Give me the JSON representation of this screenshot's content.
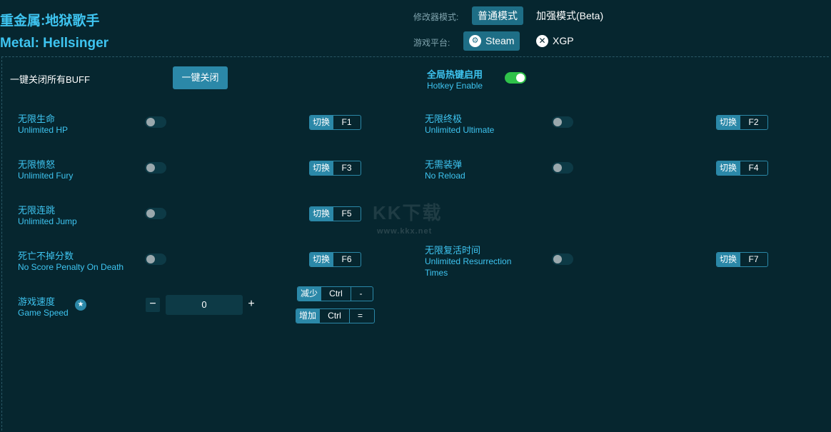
{
  "header": {
    "title_cn": "重金属:地狱歌手",
    "title_en": "Metal: Hellsinger",
    "mode_label": "修改器模式:",
    "mode_normal": "普通模式",
    "mode_enhanced": "加强模式(Beta)",
    "platform_label": "游戏平台:",
    "platform_steam": "Steam",
    "platform_xgp": "XGP",
    "steam_icon": "steam-icon",
    "xbox_icon": "xbox-icon"
  },
  "global": {
    "buff_label": "一键关闭所有BUFF",
    "close_all_button": "一键关闭",
    "hotkey_cn": "全局热键启用",
    "hotkey_en": "Hotkey Enable",
    "hotkey_enabled": true
  },
  "options": [
    {
      "cn": "无限生命",
      "en": "Unlimited HP",
      "action": "切换",
      "key": "F1"
    },
    {
      "cn": "无限终极",
      "en": "Unlimited Ultimate",
      "action": "切换",
      "key": "F2"
    },
    {
      "cn": "无限愤怒",
      "en": "Unlimited Fury",
      "action": "切换",
      "key": "F3"
    },
    {
      "cn": "无需装弹",
      "en": "No Reload",
      "action": "切换",
      "key": "F4"
    },
    {
      "cn": "无限连跳",
      "en": "Unlimited Jump",
      "action": "切换",
      "key": "F5"
    },
    {
      "cn": "死亡不掉分数",
      "en": "No Score Penalty On Death",
      "action": "切换",
      "key": "F6"
    },
    {
      "cn": "无限复活时间",
      "en": "Unlimited Resurrection Times",
      "action": "切换",
      "key": "F7"
    }
  ],
  "speed": {
    "cn": "游戏速度",
    "en": "Game Speed",
    "value": "0",
    "minus": "−",
    "plus": "+",
    "decrease": {
      "action": "减少",
      "mod": "Ctrl",
      "key": "-"
    },
    "increase": {
      "action": "增加",
      "mod": "Ctrl",
      "key": "="
    }
  },
  "watermark": {
    "text": "KK下载",
    "url": "www.kkx.net"
  },
  "colors": {
    "background": "#06262f",
    "accent": "#3ec4f0",
    "button": "#2b88a8",
    "toggle_on": "#2fc24a"
  }
}
